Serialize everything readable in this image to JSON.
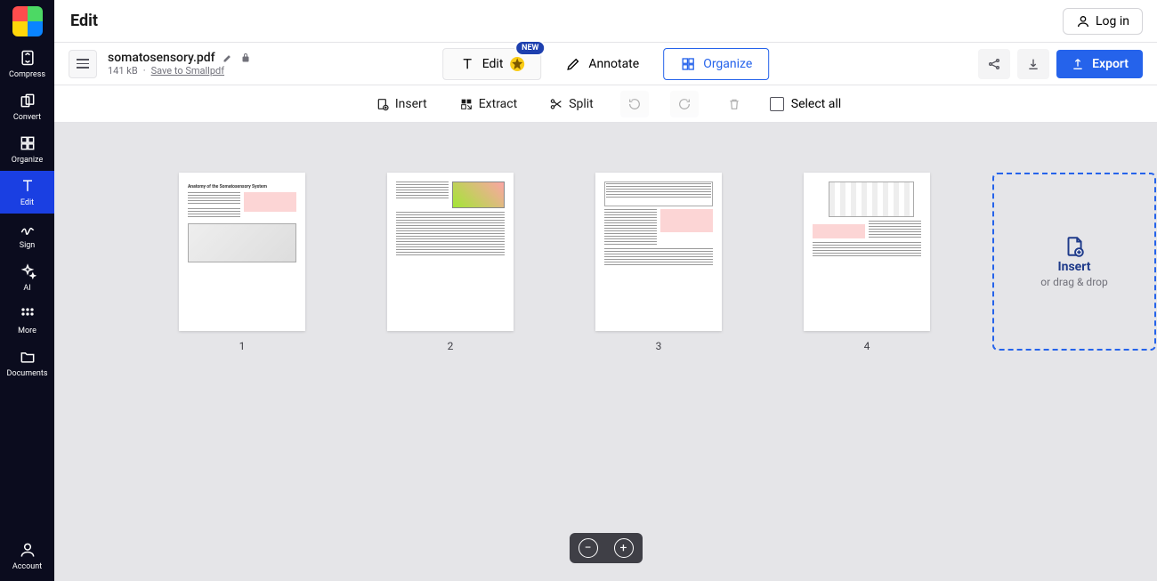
{
  "header": {
    "title": "Edit",
    "login": "Log in"
  },
  "file": {
    "name": "somatosensory.pdf",
    "size": "141 kB",
    "save_link": "Save to Smallpdf"
  },
  "sidebar": {
    "items": [
      {
        "id": "compress",
        "label": "Compress"
      },
      {
        "id": "convert",
        "label": "Convert"
      },
      {
        "id": "organize",
        "label": "Organize"
      },
      {
        "id": "edit",
        "label": "Edit"
      },
      {
        "id": "sign",
        "label": "Sign"
      },
      {
        "id": "ai",
        "label": "AI"
      },
      {
        "id": "more",
        "label": "More"
      },
      {
        "id": "documents",
        "label": "Documents"
      }
    ],
    "account_label": "Account"
  },
  "modes": {
    "edit": "Edit",
    "annotate": "Annotate",
    "organize": "Organize",
    "new_badge": "NEW"
  },
  "actions": {
    "export": "Export"
  },
  "toolbar": {
    "insert": "Insert",
    "extract": "Extract",
    "split": "Split",
    "select_all": "Select all"
  },
  "pages": [
    "1",
    "2",
    "3",
    "4"
  ],
  "page1_title": "Anatomy of the Somatosensory System",
  "drop": {
    "label": "Insert",
    "sub": "or drag & drop"
  }
}
